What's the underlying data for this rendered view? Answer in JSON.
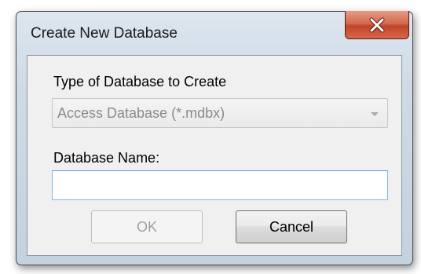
{
  "dialog": {
    "title": "Create New Database",
    "close_icon": "close-icon"
  },
  "form": {
    "type_label": "Type of Database to Create",
    "type_value": "Access Database (*.mdbx)",
    "name_label": "Database Name:",
    "name_value": ""
  },
  "buttons": {
    "ok_label": "OK",
    "cancel_label": "Cancel"
  },
  "colors": {
    "close_button": "#c7492e",
    "input_focus_border": "#7eb4ea",
    "disabled_text": "#a0a0a0"
  }
}
